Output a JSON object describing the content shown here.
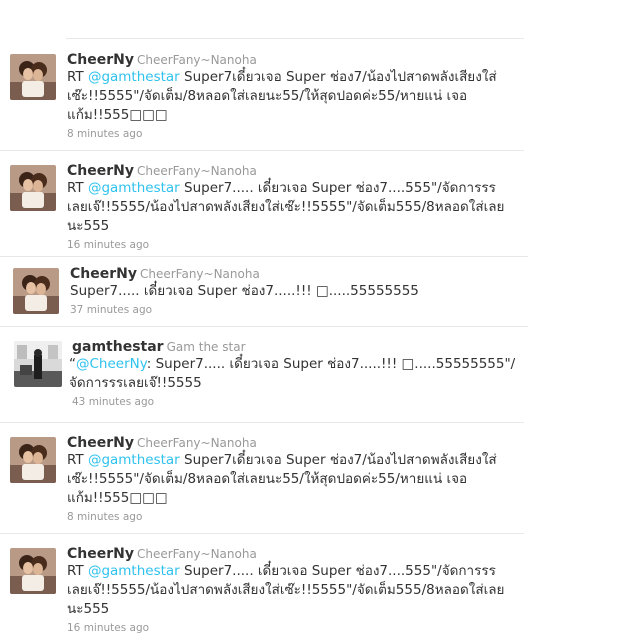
{
  "colors": {
    "link": "#2fc2ef",
    "meta": "#999999",
    "text": "#333333"
  },
  "tweets": [
    {
      "screen_name": "CheerNy",
      "full_name": "CheerFany~Nanoha",
      "prefix": "RT ",
      "mention": "@gamthestar",
      "body": " Super7เดี๋ยวเจอ Super ช่อง7/น้องไปสาดพลังเสียงใส่เซ๊ะ!!5555\"/จัดเต็ม/8หลอดใส่เลยนะ55/ให้สุดปอดค่ะ55/หายแน่ เจอแก้ม!!555□□□",
      "time": "8 minutes ago",
      "avatar_icon": "girls-photo-avatar"
    },
    {
      "screen_name": "CheerNy",
      "full_name": "CheerFany~Nanoha",
      "prefix": "RT ",
      "mention": "@gamthestar",
      "body": " Super7..... เดี๋ยวเจอ Super ช่อง7....555\"/จัดการรรเลยเจ๊!!5555/น้องไปสาดพลังเสียงใส่เซ๊ะ!!5555\"/จัดเต็ม555/8หลอดใส่เลยนะ555",
      "time": "16 minutes ago",
      "avatar_icon": "girls-photo-avatar"
    },
    {
      "screen_name": "CheerNy",
      "full_name": "CheerFany~Nanoha",
      "prefix": "",
      "mention": "",
      "body": "Super7..... เดี๋ยวเจอ Super ช่อง7.....!!! □.....55555555",
      "time": "37 minutes ago",
      "avatar_icon": "girls-photo-avatar"
    },
    {
      "screen_name": "gamthestar",
      "full_name": "Gam the star",
      "prefix": "“",
      "mention": "@CheerNy",
      "body": ": Super7..... เดี๋ยวเจอ Super ช่อง7.....!!! □.....55555555\"/จัดการรรเลยเจ๊!!5555",
      "time": "43 minutes ago",
      "avatar_icon": "bw-room-photo-avatar"
    },
    {
      "screen_name": "CheerNy",
      "full_name": "CheerFany~Nanoha",
      "prefix": "RT ",
      "mention": "@gamthestar",
      "body": " Super7เดี๋ยวเจอ Super ช่อง7/น้องไปสาดพลังเสียงใส่เซ๊ะ!!5555\"/จัดเต็ม/8หลอดใส่เลยนะ55/ให้สุดปอดค่ะ55/หายแน่ เจอแก้ม!!555□□□",
      "time": "8 minutes ago",
      "avatar_icon": "girls-photo-avatar"
    },
    {
      "screen_name": "CheerNy",
      "full_name": "CheerFany~Nanoha",
      "prefix": "RT ",
      "mention": "@gamthestar",
      "body": " Super7..... เดี๋ยวเจอ Super ช่อง7....555\"/จัดการรรเลยเจ๊!!5555/น้องไปสาดพลังเสียงใส่เซ๊ะ!!5555\"/จัดเต็ม555/8หลอดใส่เลยนะ555",
      "time": "16 minutes ago",
      "avatar_icon": "girls-photo-avatar"
    }
  ]
}
